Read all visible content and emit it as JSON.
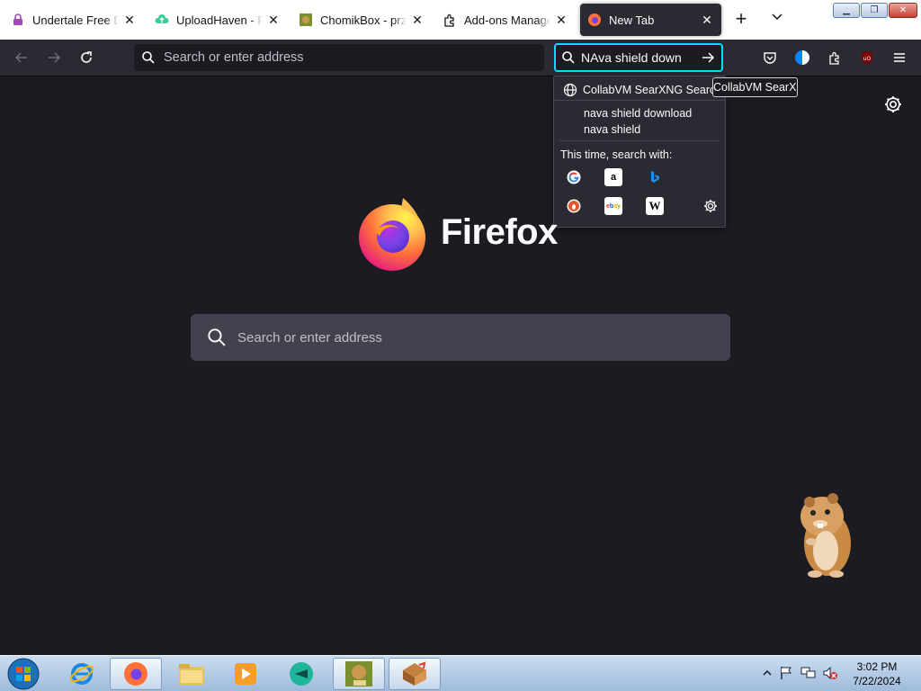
{
  "tabs": [
    {
      "title": "Undertale Free Download",
      "icon": "lock-icon",
      "active": false
    },
    {
      "title": "UploadHaven - File",
      "icon": "uploadhaven-icon",
      "active": false
    },
    {
      "title": "ChomikBox - przyjęte",
      "icon": "chomikbox-icon",
      "active": false
    },
    {
      "title": "Add-ons Manager",
      "icon": "puzzle-icon",
      "active": false
    },
    {
      "title": "New Tab",
      "icon": "firefox-icon",
      "active": true
    }
  ],
  "navbar": {
    "urlbar_placeholder": "Search or enter address",
    "searchbar_value": "NAva shield down"
  },
  "search_popup": {
    "engine_label": "CollabVM SearXNG Search",
    "suggestions": [
      "nava shield download",
      "nava shield"
    ],
    "this_time_label": "This time, search with:",
    "engines": [
      "google",
      "amazon",
      "bing",
      "duckduckgo",
      "ebay",
      "wikipedia"
    ]
  },
  "tooltip": {
    "text": "CollabVM SearXNG"
  },
  "newtab": {
    "wordmark": "Firefox",
    "search_placeholder": "Search or enter address"
  },
  "taskbar": {
    "time": "3:02 PM",
    "date": "7/22/2024",
    "apps": [
      "start",
      "internet-explorer",
      "firefox",
      "file-explorer",
      "media-player",
      "chomik-app",
      "chomikbox",
      "installer"
    ]
  },
  "colors": {
    "accent": "#00ddff",
    "toolbar": "#2b2a33",
    "content": "#1c1b22"
  }
}
